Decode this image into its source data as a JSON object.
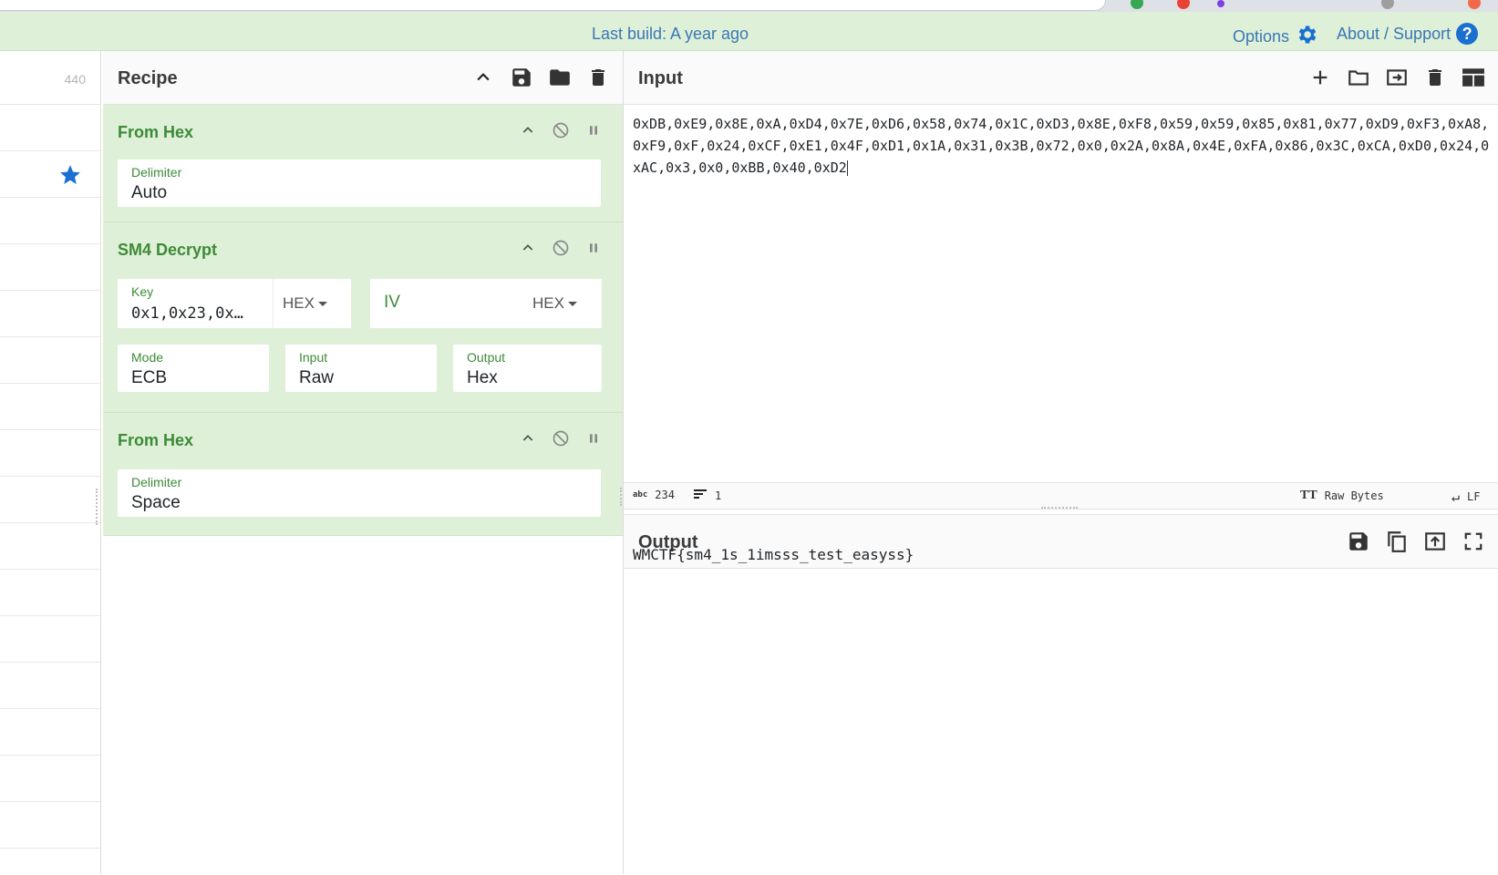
{
  "banner": {
    "last_build": "Last build: A year ago",
    "options_label": "Options",
    "about_label": "About / Support"
  },
  "operations": {
    "count_text": "440"
  },
  "recipe": {
    "title": "Recipe",
    "ops": [
      {
        "name": "From Hex",
        "delimiter_label": "Delimiter",
        "delimiter_value": "Auto"
      },
      {
        "name": "SM4 Decrypt",
        "key_label": "Key",
        "key_value": "0x1,0x23,0x…",
        "key_format": "HEX",
        "iv_placeholder": "IV",
        "iv_format": "HEX",
        "mode_label": "Mode",
        "mode_value": "ECB",
        "input_label": "Input",
        "input_value": "Raw",
        "output_label": "Output",
        "output_value": "Hex"
      },
      {
        "name": "From Hex",
        "delimiter_label": "Delimiter",
        "delimiter_value": "Space"
      }
    ]
  },
  "input": {
    "title": "Input",
    "text": "0xDB,0xE9,0x8E,0xA,0xD4,0x7E,0xD6,0x58,0x74,0x1C,0xD3,0x8E,0xF8,0x59,0x59,0x85,0x81,0x77,0xD9,0xF3,0xA8,0xF9,0xF,0x24,0xCF,0xE1,0x4F,0xD1,0x1A,0x31,0x3B,0x72,0x0,0x2A,0x8A,0x4E,0xFA,0x86,0x3C,0xCA,0xD0,0x24,0xAC,0x3,0x0,0xBB,0x40,0xD2"
  },
  "status": {
    "abc_icon": "abc",
    "length": "234",
    "lines": "1",
    "encoding": "Raw Bytes",
    "eol": "LF"
  },
  "output": {
    "title": "Output",
    "text": "WMCTF{sm4_1s_1imsss_test_easyss}"
  },
  "colors": {
    "accent": "#3a78b5",
    "op_bg": "#dff0d8",
    "op_text": "#3d8b37",
    "star": "#1a6fd1"
  }
}
